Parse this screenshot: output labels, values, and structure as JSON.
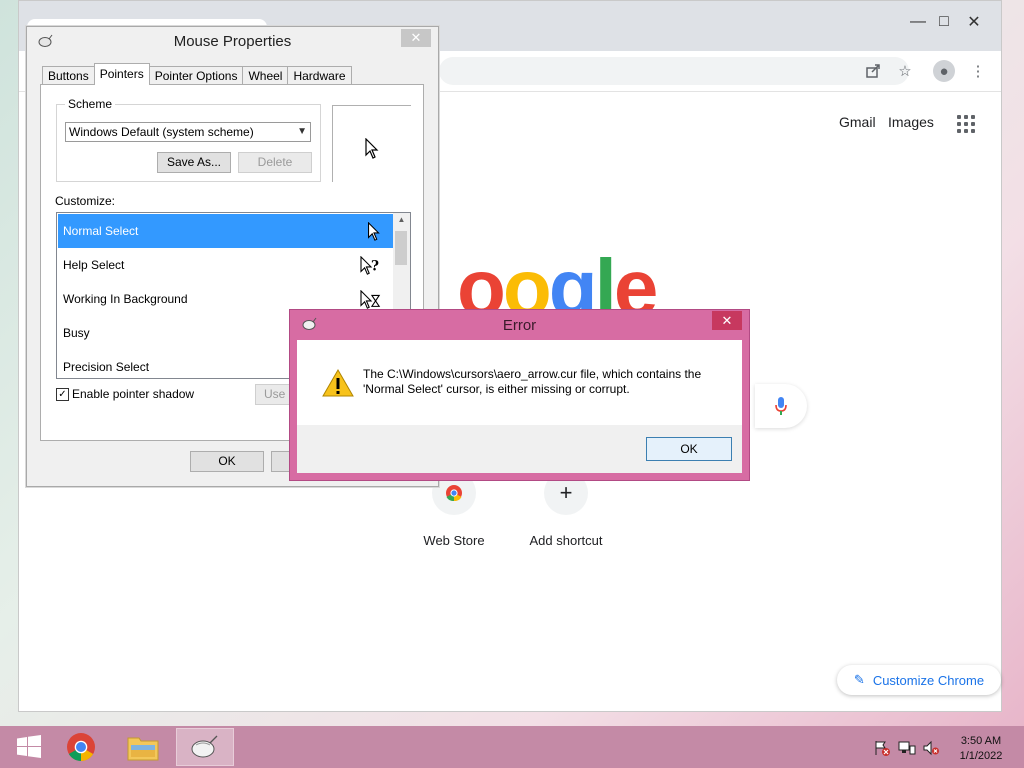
{
  "chrome": {
    "top_links": [
      "Gmail",
      "Images"
    ],
    "logo_letters": [
      "o",
      "o",
      "g",
      "l",
      "e"
    ],
    "logo_colors": [
      "#ea4335",
      "#fbbc05",
      "#4285f4",
      "#34a853",
      "#ea4335"
    ],
    "shortcuts": [
      {
        "label": "Web Store",
        "icon": "chrome-webstore-icon"
      },
      {
        "label": "Add shortcut",
        "icon": "plus-icon",
        "glyph": "+"
      }
    ],
    "customize_label": "Customize Chrome"
  },
  "mouse_properties": {
    "title": "Mouse Properties",
    "tabs": [
      "Buttons",
      "Pointers",
      "Pointer Options",
      "Wheel",
      "Hardware"
    ],
    "active_tab": "Pointers",
    "scheme_label": "Scheme",
    "scheme_value": "Windows Default (system scheme)",
    "save_as_label": "Save As...",
    "delete_label": "Delete",
    "customize_label": "Customize:",
    "cursor_rows": [
      {
        "label": "Normal Select",
        "icon": "arrow-cursor-icon",
        "selected": true
      },
      {
        "label": "Help Select",
        "icon": "help-cursor-icon",
        "selected": false
      },
      {
        "label": "Working In Background",
        "icon": "working-cursor-icon",
        "selected": false
      },
      {
        "label": "Busy",
        "icon": "busy-cursor-icon",
        "selected": false
      },
      {
        "label": "Precision Select",
        "icon": "precision-cursor-icon",
        "selected": false
      }
    ],
    "shadow_label": "Enable pointer shadow",
    "shadow_checked": true,
    "use_default_label": "Use D",
    "ok_label": "OK"
  },
  "error_dialog": {
    "title": "Error",
    "message": "The C:\\Windows\\cursors\\aero_arrow.cur file, which contains the 'Normal Select' cursor, is either missing or corrupt.",
    "ok_label": "OK"
  },
  "taskbar": {
    "time": "3:50 AM",
    "date": "1/1/2022"
  }
}
